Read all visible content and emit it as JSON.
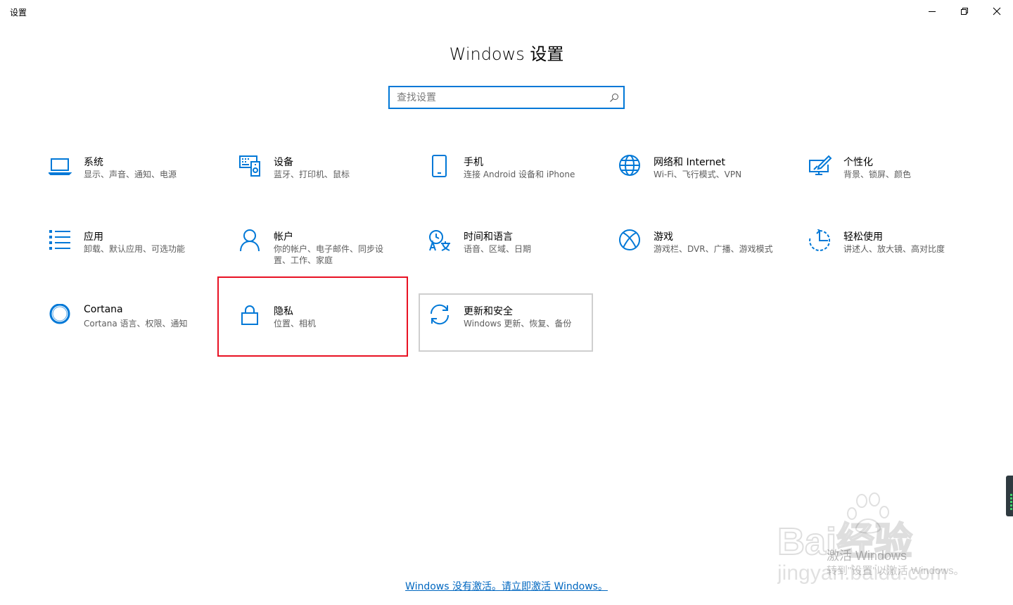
{
  "app": {
    "title": "设置"
  },
  "header": {
    "title": "Windows 设置"
  },
  "search": {
    "placeholder": "查找设置",
    "value": ""
  },
  "tiles": [
    {
      "name": "系统",
      "desc": "显示、声音、通知、电源",
      "icon": "laptop-icon"
    },
    {
      "name": "设备",
      "desc": "蓝牙、打印机、鼠标",
      "icon": "devices-icon"
    },
    {
      "name": "手机",
      "desc": "连接 Android 设备和 iPhone",
      "icon": "phone-icon"
    },
    {
      "name": "网络和 Internet",
      "desc": "Wi-Fi、飞行模式、VPN",
      "icon": "globe-icon"
    },
    {
      "name": "个性化",
      "desc": "背景、锁屏、颜色",
      "icon": "paint-brush-icon"
    },
    {
      "name": "应用",
      "desc": "卸载、默认应用、可选功能",
      "icon": "apps-list-icon"
    },
    {
      "name": "帐户",
      "desc": "你的帐户、电子邮件、同步设置、工作、家庭",
      "icon": "person-icon"
    },
    {
      "name": "时间和语言",
      "desc": "语音、区域、日期",
      "icon": "time-language-icon"
    },
    {
      "name": "游戏",
      "desc": "游戏栏、DVR、广播、游戏模式",
      "icon": "xbox-icon"
    },
    {
      "name": "轻松使用",
      "desc": "讲述人、放大镜、高对比度",
      "icon": "ease-of-access-icon"
    },
    {
      "name": "Cortana",
      "desc": "Cortana 语言、权限、通知",
      "icon": "cortana-icon"
    },
    {
      "name": "隐私",
      "desc": "位置、相机",
      "icon": "lock-icon"
    },
    {
      "name": "更新和安全",
      "desc": "Windows 更新、恢复、备份",
      "icon": "sync-icon"
    }
  ],
  "activation": {
    "link": "Windows 没有激活。请立即激活 Windows。",
    "watermark_title": "激活 Windows",
    "watermark_sub": "转到\"设置\"以激活 Windows。"
  },
  "watermark": {
    "brand": "Bai经验",
    "url": "jingyan.baidu.com"
  },
  "colors": {
    "accent": "#0078d7",
    "highlight": "#e81123",
    "link": "#0067c0"
  }
}
